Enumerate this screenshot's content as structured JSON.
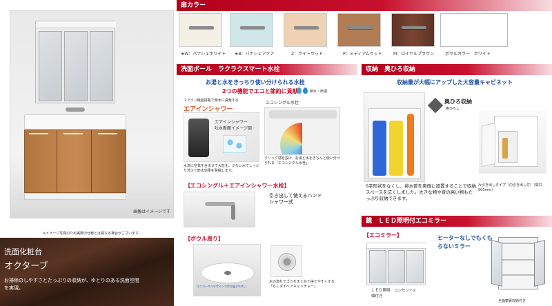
{
  "door_color": {
    "header": "扉カラー",
    "swatches": [
      {
        "label": "★W：パナシェホワイト",
        "color": "#f4f0e6"
      },
      {
        "label": "★B：パナシェアクア",
        "color": "#cfe7e9"
      },
      {
        "label": "Z：ライトウッド",
        "color": "#efd2b3"
      },
      {
        "label": "P：ミディアムウッド",
        "color": "#b27c55"
      },
      {
        "label": "M：ロイヤルブラウン",
        "color": "#6b3b29"
      }
    ],
    "bowl_label": "ボウルカラー　ホワイト"
  },
  "product": {
    "photo_caption": "画像はイメージです",
    "note": "※イメージ写真のため実際の仕様とは異なる場合がございます。",
    "category": "洗面化粧台",
    "name": "オクターブ",
    "description": "お掃除のしやすさとたっぷりの収納が、ゆとりのある洗面空間を実現。"
  },
  "bowl_section": {
    "header": "洗面ボール　ラクラクスマート水栓",
    "headline": "お湯と水をきっちり使い分けられる水栓",
    "subheadline": "2つの機能でエコと節約に貢献",
    "eco_icon_label": "節水・節湯",
    "air_in_small": "エアイン機能搭載で節水に貢献する",
    "air_in_title": "エアインシャワー",
    "air_in_image_title": "エアインシャワー",
    "air_in_image_sub": "吐水断面イメージ図",
    "air_in_text": "水流に空気を含ませて大粒化。少ない水でしっかり洗えて節水効果を発揮します。",
    "eco_single_title": "エコシングル水栓",
    "eco_single_text": "クリック感を設け、お湯と水をきちんと使い分けられる「エコシングル水栓」。",
    "feature_heading": "【エコシングル＋エアインシャワー水栓】",
    "hand_shower": "引き出して使えるハンドシャワー式",
    "bowl_heading": "【ボウル周り】",
    "bowl_image_text": "ユニバーサルデザインで手が届きやすい",
    "catcher_text": "水の流れでゴミをまとめて捨てやすくする「らくポイヘアキャッチャー」"
  },
  "storage": {
    "header": "収納　奥ひろ収納",
    "headline": "収納量が大幅にアップした大容量キャビネット",
    "badge_title": "奥ひろ収納",
    "badge_sub": "奥ひろし",
    "description": "S字形状をなくし、排水管を奥側に設置することで収納スペースを広くしました。大きな物や背の高い物もたっぷり収納できます。",
    "cabinet_caption": "片引き出しタイプ（内引き出し付）（間口900mm）"
  },
  "mirror": {
    "header": "鏡　ＬＥＤ照明付エコミラー",
    "label": "【エコミラー】",
    "catch": "ヒーターなしでもくもらないミラー",
    "led_caption": "ＬＥＤ照明　コンセント2個付き",
    "storage_caption": "全面鏡裏収納付き"
  }
}
